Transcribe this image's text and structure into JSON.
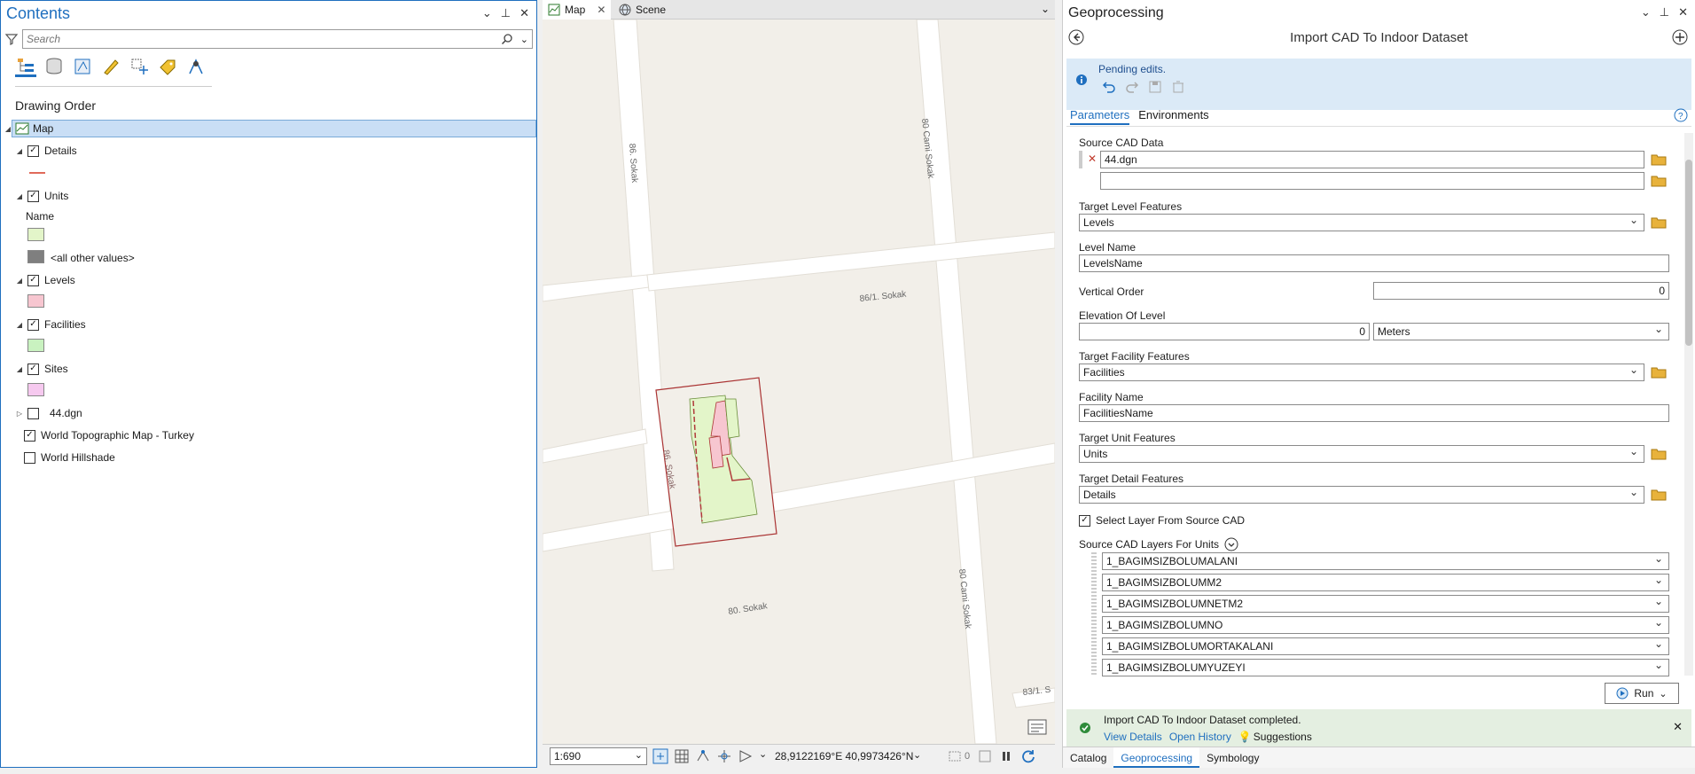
{
  "contents": {
    "title": "Contents",
    "search_placeholder": "Search",
    "section_title": "Drawing Order",
    "map_label": "Map",
    "details_label": "Details",
    "units_label": "Units",
    "units_field": "Name",
    "all_other_values": "<all other values>",
    "levels_label": "Levels",
    "facilities_label": "Facilities",
    "sites_label": "Sites",
    "cad_label": "44.dgn",
    "topo_label": "World Topographic Map - Turkey",
    "hillshade_label": "World Hillshade",
    "colors": {
      "details_line": "#e06a5a",
      "units_swatch": "#e3f5c9",
      "other_swatch": "#7f7f7f",
      "levels_swatch": "#f7c6d0",
      "facilities_swatch": "#c9f2c0",
      "sites_swatch": "#f6c9ef"
    }
  },
  "map": {
    "tab_map": "Map",
    "tab_scene": "Scene",
    "streets": {
      "s1": "86. Sokak",
      "s2": "80 Cami Sokak",
      "s3": "86/1. Sokak",
      "s4": "86. Sokak",
      "s5": "80. Sokak",
      "s6": "80 Cami Sokak",
      "s7": "83/1. S"
    },
    "scale": "1:690",
    "coordinates": "28,9122169°E 40,9973426°N",
    "selection_count": "0"
  },
  "geoprocessing": {
    "title": "Geoprocessing",
    "tool_title": "Import CAD To Indoor Dataset",
    "pending_text": "Pending edits.",
    "tab_parameters": "Parameters",
    "tab_environments": "Environments",
    "source_cad_label": "Source CAD Data",
    "source_cad_value": "44.dgn",
    "target_level_label": "Target Level Features",
    "target_level_value": "Levels",
    "level_name_label": "Level Name",
    "level_name_value": "LevelsName",
    "vertical_order_label": "Vertical Order",
    "vertical_order_value": "0",
    "elevation_label": "Elevation Of Level",
    "elevation_value": "0",
    "elevation_unit": "Meters",
    "target_facility_label": "Target Facility Features",
    "target_facility_value": "Facilities",
    "facility_name_label": "Facility Name",
    "facility_name_value": "FacilitiesName",
    "target_unit_label": "Target Unit Features",
    "target_unit_value": "Units",
    "target_detail_label": "Target Detail Features",
    "target_detail_value": "Details",
    "select_layer_label": "Select Layer From Source CAD",
    "source_layers_label": "Source CAD Layers For Units",
    "layers": [
      "1_BAGIMSIZBOLUMALANI",
      "1_BAGIMSIZBOLUMM2",
      "1_BAGIMSIZBOLUMNETM2",
      "1_BAGIMSIZBOLUMNO",
      "1_BAGIMSIZBOLUMORTAKALANI",
      "1_BAGIMSIZBOLUMYUZEYI"
    ],
    "run_label": "Run",
    "completed_text": "Import CAD To Indoor Dataset completed.",
    "view_details": "View Details",
    "open_history": "Open History",
    "suggestions": "Suggestions",
    "bottom_tabs": {
      "catalog": "Catalog",
      "geoprocessing": "Geoprocessing",
      "symbology": "Symbology"
    }
  }
}
